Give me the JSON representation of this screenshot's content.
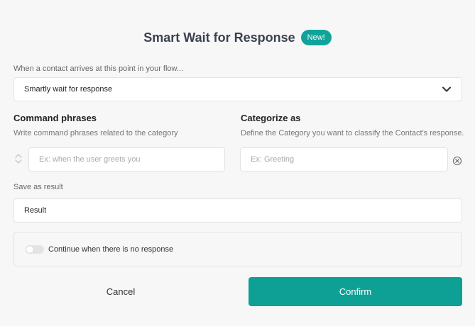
{
  "header": {
    "title": "Smart Wait for Response",
    "badge": "New!"
  },
  "trigger": {
    "label": "When a contact arrives at this point in your flow...",
    "selected": "Smartly wait for response"
  },
  "command_phrases": {
    "heading": "Command phrases",
    "hint": "Write command phrases related to the category",
    "placeholder": "Ex: when the user greets you"
  },
  "categorize": {
    "heading": "Categorize as",
    "hint": "Define the Category you want to classify the Contact's response.",
    "placeholder": "Ex: Greeting"
  },
  "save_result": {
    "label": "Save as result",
    "value": "Result"
  },
  "no_response_toggle": {
    "label": "Continue when there is no response",
    "enabled": false
  },
  "actions": {
    "cancel": "Cancel",
    "confirm": "Confirm"
  },
  "colors": {
    "accent": "#0fa095"
  }
}
